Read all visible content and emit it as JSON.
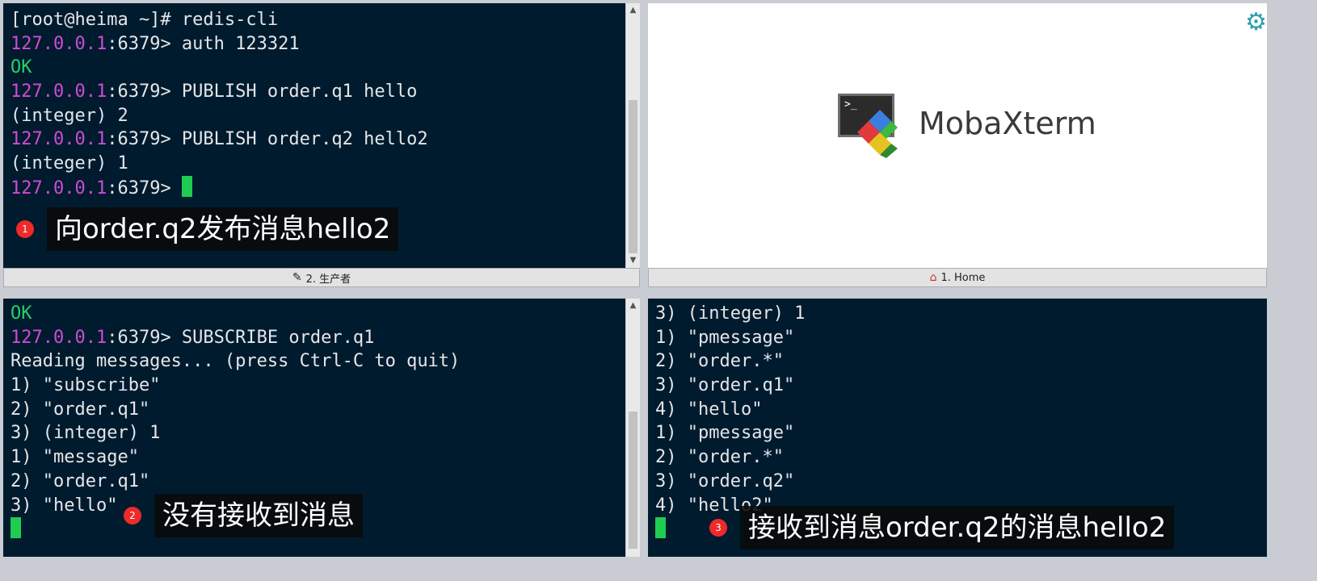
{
  "panes": {
    "producer": {
      "tab_label": "2. 生产者",
      "lines": [
        {
          "segments": [
            {
              "t": "[root@heima ~]# redis-cli",
              "c": ""
            }
          ]
        },
        {
          "segments": [
            {
              "t": "127.0.0.1",
              "c": "ip"
            },
            {
              "t": ":6379> auth 123321",
              "c": ""
            }
          ]
        },
        {
          "segments": [
            {
              "t": "OK",
              "c": "ok"
            }
          ]
        },
        {
          "segments": [
            {
              "t": "127.0.0.1",
              "c": "ip"
            },
            {
              "t": ":6379> PUBLISH order.q1 hello",
              "c": ""
            }
          ]
        },
        {
          "segments": [
            {
              "t": "(integer) 2",
              "c": ""
            }
          ]
        },
        {
          "segments": [
            {
              "t": "127.0.0.1",
              "c": "ip"
            },
            {
              "t": ":6379> PUBLISH order.q2 hello2",
              "c": ""
            }
          ]
        },
        {
          "segments": [
            {
              "t": "(integer) 1",
              "c": ""
            }
          ]
        },
        {
          "segments": [
            {
              "t": "127.0.0.1",
              "c": "ip"
            },
            {
              "t": ":6379> ",
              "c": ""
            }
          ],
          "cursor": true
        }
      ],
      "annotation": {
        "badge": "1",
        "text": "向order.q2发布消息hello2"
      }
    },
    "home": {
      "tab_label": "1. Home",
      "brand": "MobaXterm",
      "logo_prompt": ">_"
    },
    "subscriber": {
      "lines": [
        {
          "segments": [
            {
              "t": "OK",
              "c": "ok"
            }
          ]
        },
        {
          "segments": [
            {
              "t": "127.0.0.1",
              "c": "ip"
            },
            {
              "t": ":6379> SUBSCRIBE order.q1",
              "c": ""
            }
          ]
        },
        {
          "segments": [
            {
              "t": "Reading messages... (press Ctrl-C to quit)",
              "c": ""
            }
          ]
        },
        {
          "segments": [
            {
              "t": "1) \"subscribe\"",
              "c": ""
            }
          ]
        },
        {
          "segments": [
            {
              "t": "2) \"order.q1\"",
              "c": ""
            }
          ]
        },
        {
          "segments": [
            {
              "t": "3) (integer) 1",
              "c": ""
            }
          ]
        },
        {
          "segments": [
            {
              "t": "1) \"message\"",
              "c": ""
            }
          ]
        },
        {
          "segments": [
            {
              "t": "2) \"order.q1\"",
              "c": ""
            }
          ]
        },
        {
          "segments": [
            {
              "t": "3) \"hello\"",
              "c": ""
            }
          ]
        },
        {
          "segments": [],
          "cursor": true
        }
      ],
      "annotation": {
        "badge": "2",
        "text": "没有接收到消息"
      }
    },
    "psubscriber": {
      "lines": [
        {
          "segments": [
            {
              "t": "3) (integer) 1",
              "c": ""
            }
          ]
        },
        {
          "segments": [
            {
              "t": "1) \"pmessage\"",
              "c": ""
            }
          ]
        },
        {
          "segments": [
            {
              "t": "2) \"order.*\"",
              "c": ""
            }
          ]
        },
        {
          "segments": [
            {
              "t": "3) \"order.q1\"",
              "c": ""
            }
          ]
        },
        {
          "segments": [
            {
              "t": "4) \"hello\"",
              "c": ""
            }
          ]
        },
        {
          "segments": [
            {
              "t": "1) \"pmessage\"",
              "c": ""
            }
          ]
        },
        {
          "segments": [
            {
              "t": "2) \"order.*\"",
              "c": ""
            }
          ]
        },
        {
          "segments": [
            {
              "t": "3) \"order.q2\"",
              "c": ""
            }
          ]
        },
        {
          "segments": [
            {
              "t": "4) \"hello2\"",
              "c": ""
            }
          ]
        },
        {
          "segments": [],
          "cursor": true
        }
      ],
      "annotation": {
        "badge": "3",
        "text": "接收到消息order.q2的消息hello2"
      }
    }
  },
  "colors": {
    "terminal_bg": "#001b2e",
    "prompt_ip": "#d04ad6",
    "ok_green": "#25d06a",
    "cursor_green": "#1fcc52"
  },
  "icons": {
    "producer_tab": "brush-icon",
    "home_tab": "home-icon",
    "settings": "gear-icon"
  }
}
